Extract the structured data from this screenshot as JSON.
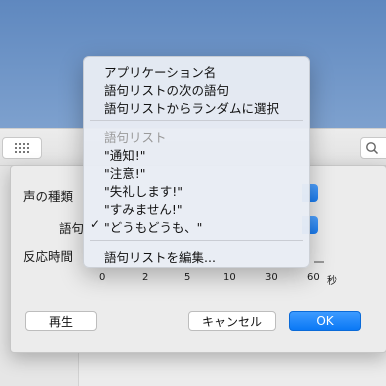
{
  "sheet": {
    "voice_type_label": "声の種類",
    "phrase_label": "語句",
    "reaction_time_label": "反応時間",
    "slider_ticks": [
      "0",
      "2",
      "5",
      "10",
      "30",
      "60"
    ],
    "slider_unit": "秒",
    "play_button": "再生",
    "cancel_button": "キャンセル",
    "ok_button": "OK"
  },
  "menu": {
    "items": [
      "アプリケーション名",
      "語句リストの次の語句",
      "語句リストからランダムに選択"
    ],
    "section_header": "語句リスト",
    "phrases": [
      "\"通知!\"",
      "\"注意!\"",
      "\"失礼します!\"",
      "\"すみません!\"",
      "\"どうもどうも、\""
    ],
    "selected_phrase_index": 4,
    "check_mark": "✓",
    "edit_item": "語句リストを編集..."
  },
  "colors": {
    "accent": "#0a78f5",
    "desktop": "#7fa2cf"
  }
}
